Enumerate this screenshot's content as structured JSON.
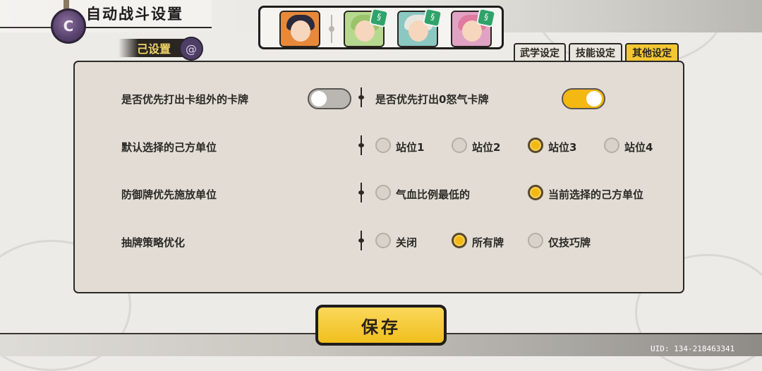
{
  "header": {
    "title": "自动战斗设置",
    "badge_glyph": "C"
  },
  "subtab": {
    "label": "己设置"
  },
  "team": [
    {
      "name": "hero-1",
      "bg": "#e8893a",
      "hair": "#2a2a3a",
      "element": false
    },
    {
      "name": "hero-2",
      "bg": "#b7d98f",
      "hair": "#9bc46a",
      "element": true
    },
    {
      "name": "hero-3",
      "bg": "#8bc8c1",
      "hair": "#e7e7e0",
      "element": true
    },
    {
      "name": "hero-4",
      "bg": "#e0a3c4",
      "hair": "#e07aa0",
      "element": true
    }
  ],
  "tabs": [
    {
      "label": "武学设定",
      "active": false
    },
    {
      "label": "技能设定",
      "active": false
    },
    {
      "label": "其他设定",
      "active": true
    }
  ],
  "settings": {
    "row1": {
      "left_label": "是否优先打出卡组外的卡牌",
      "left_toggle_on": false,
      "right_label": "是否优先打出0怒气卡牌",
      "right_toggle_on": true
    },
    "row2": {
      "label": "默认选择的己方单位",
      "options": [
        "站位1",
        "站位2",
        "站位3",
        "站位4"
      ],
      "selected": "站位3"
    },
    "row3": {
      "label": "防御牌优先施放单位",
      "options": [
        "气血比例最低的",
        "当前选择的己方单位"
      ],
      "selected": "当前选择的己方单位"
    },
    "row4": {
      "label": "抽牌策略优化",
      "options": [
        "关闭",
        "所有牌",
        "仅技巧牌"
      ],
      "selected": "所有牌"
    }
  },
  "save_button": {
    "label": "保存"
  },
  "footer": {
    "uid": "UID:  134-218463341"
  },
  "colors": {
    "accent": "#f4b813",
    "panel": "#e2dcd5",
    "border": "#2b2926"
  }
}
